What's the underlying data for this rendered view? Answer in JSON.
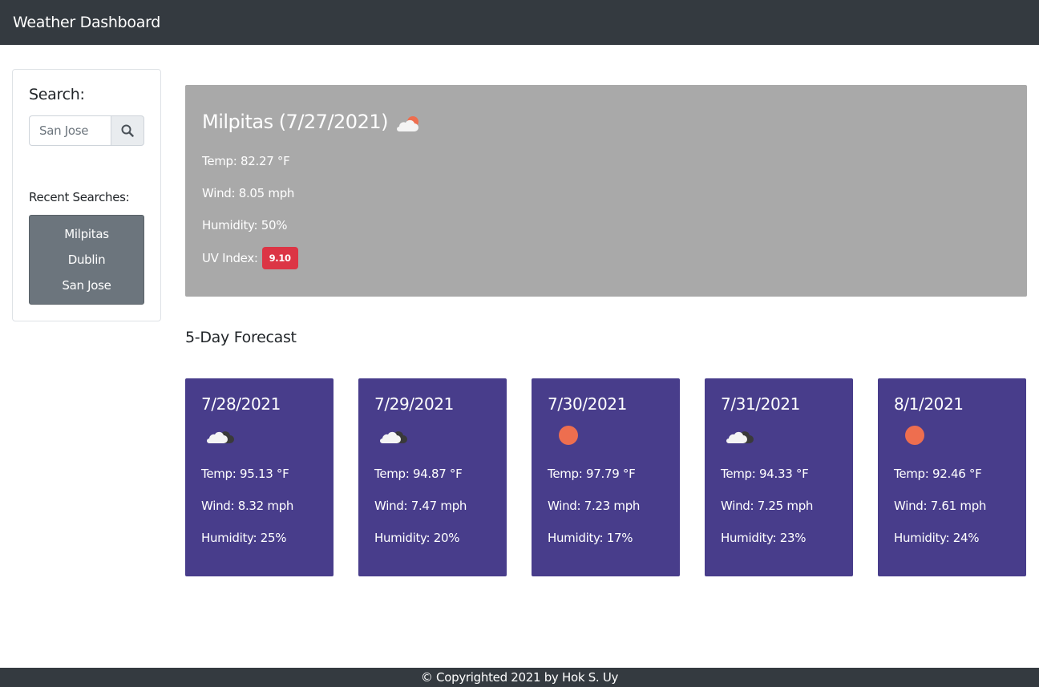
{
  "header": {
    "title": "Weather Dashboard"
  },
  "sidebar": {
    "search_label": "Search:",
    "search_placeholder": "San Jose",
    "search_icon": "search-icon",
    "recent_label": "Recent Searches:",
    "recent": [
      "Milpitas",
      "Dublin",
      "San Jose"
    ]
  },
  "current": {
    "title": "Milpitas (7/27/2021)",
    "icon": "partly-cloudy-sun-icon",
    "temp": "Temp: 82.27 °F",
    "wind": "Wind: 8.05 mph",
    "humidity": "Humidity: 50%",
    "uv_label": "UV Index:",
    "uv_value": "9.10",
    "uv_color": "#dc3545"
  },
  "forecast": {
    "title": "5-Day Forecast",
    "days": [
      {
        "date": "7/28/2021",
        "icon": "cloudy-icon",
        "temp": "Temp: 95.13 °F",
        "wind": "Wind: 8.32 mph",
        "humidity": "Humidity: 25%"
      },
      {
        "date": "7/29/2021",
        "icon": "cloudy-icon",
        "temp": "Temp: 94.87 °F",
        "wind": "Wind: 7.47 mph",
        "humidity": "Humidity: 20%"
      },
      {
        "date": "7/30/2021",
        "icon": "sun-icon",
        "temp": "Temp: 97.79 °F",
        "wind": "Wind: 7.23 mph",
        "humidity": "Humidity: 17%"
      },
      {
        "date": "7/31/2021",
        "icon": "cloudy-icon",
        "temp": "Temp: 94.33 °F",
        "wind": "Wind: 7.25 mph",
        "humidity": "Humidity: 23%"
      },
      {
        "date": "8/1/2021",
        "icon": "sun-icon",
        "temp": "Temp: 92.46 °F",
        "wind": "Wind: 7.61 mph",
        "humidity": "Humidity: 24%"
      }
    ]
  },
  "footer": {
    "text": "© Copyrighted 2021 by Hok S. Uy"
  },
  "colors": {
    "navbar": "#343a40",
    "current_bg": "#a9a9a9",
    "card_bg": "#483d8b",
    "recent_bg": "#6c757d",
    "sun": "#ee6e4f"
  }
}
